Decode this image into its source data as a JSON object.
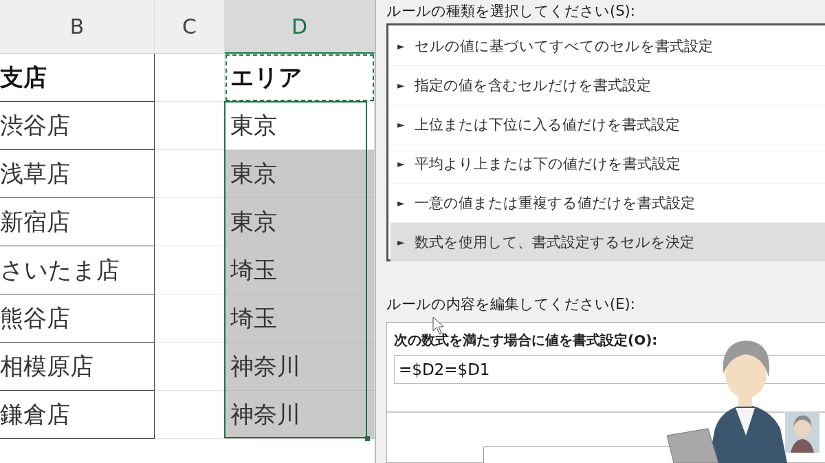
{
  "spreadsheet": {
    "columns": [
      {
        "label": "B",
        "selected": false
      },
      {
        "label": "C",
        "selected": false
      },
      {
        "label": "D",
        "selected": true
      }
    ],
    "rows": [
      {
        "b": "支店",
        "d": "エリア",
        "header": true,
        "highlighted": false
      },
      {
        "b": "渋谷店",
        "d": "東京",
        "header": false,
        "highlighted": false
      },
      {
        "b": "浅草店",
        "d": "東京",
        "header": false,
        "highlighted": true
      },
      {
        "b": "新宿店",
        "d": "東京",
        "header": false,
        "highlighted": true
      },
      {
        "b": "さいたま店",
        "d": "埼玉",
        "header": false,
        "highlighted": true
      },
      {
        "b": "熊谷店",
        "d": "埼玉",
        "header": false,
        "highlighted": true
      },
      {
        "b": "相模原店",
        "d": "神奈川",
        "header": false,
        "highlighted": true
      },
      {
        "b": "鎌倉店",
        "d": "神奈川",
        "header": false,
        "highlighted": true
      }
    ]
  },
  "dialog": {
    "rule_type_label": "ルールの種類を選択してください(S):",
    "rule_types": [
      {
        "label": "セルの値に基づいてすべてのセルを書式設定",
        "selected": false
      },
      {
        "label": "指定の値を含むセルだけを書式設定",
        "selected": false
      },
      {
        "label": "上位または下位に入る値だけを書式設定",
        "selected": false
      },
      {
        "label": "平均より上または下の値だけを書式設定",
        "selected": false
      },
      {
        "label": "一意の値または重複する値だけを書式設定",
        "selected": false
      },
      {
        "label": "数式を使用して、書式設定するセルを決定",
        "selected": true
      }
    ],
    "bullet": "►",
    "edit_label": "ルールの内容を編集してください(E):",
    "formula_label": "次の数式を満たす場合に値を書式設定(O):",
    "formula": "=$D2=$D1"
  }
}
